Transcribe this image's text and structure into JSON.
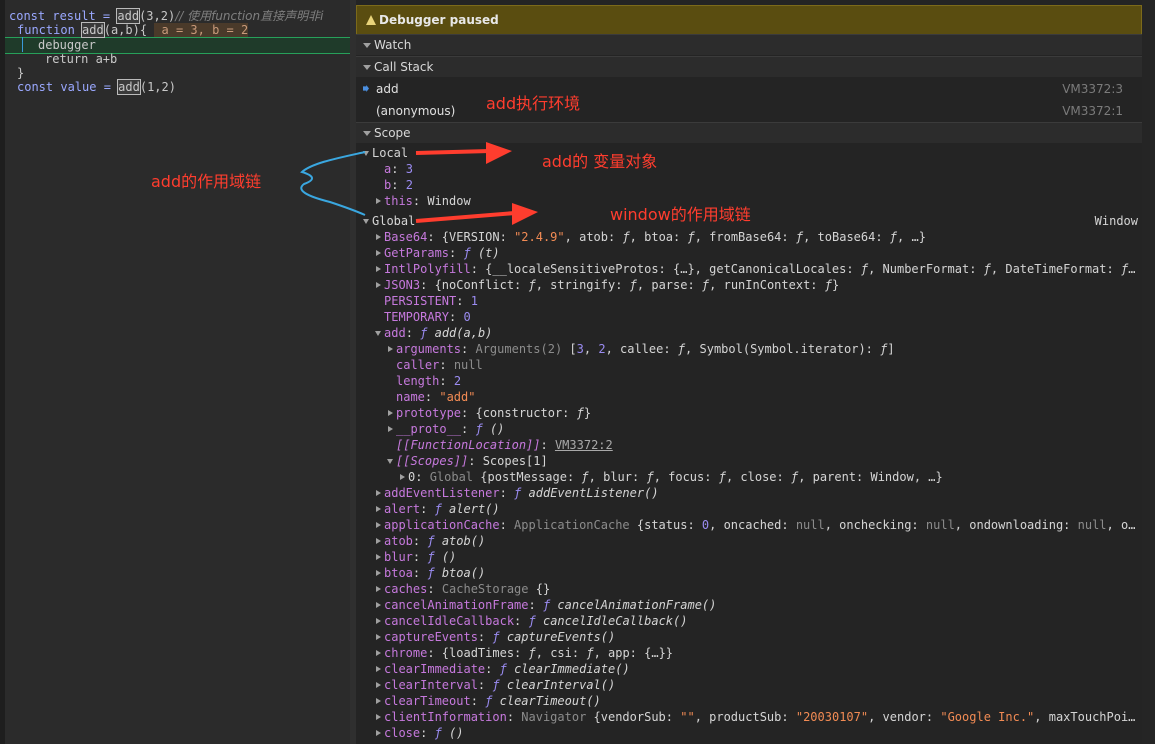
{
  "editor": {
    "line1": {
      "a": "const result = ",
      "fn": "add",
      "b": "(3,2)",
      "c": "// 使用function直接声明非i"
    },
    "line2": {
      "a": "function ",
      "fn": "add",
      "b": "(a,b){ ",
      "v": " a = 3, b = 2"
    },
    "line3": "debugger",
    "line4": "return a+b",
    "line5": "}",
    "line6": {
      "a": "const value = ",
      "fn": "add",
      "b": "(1,2)"
    }
  },
  "debugger": {
    "paused_label": "Debugger paused",
    "watch_label": "Watch",
    "callstack_label": "Call Stack",
    "scope_label": "Scope",
    "call_stack": [
      {
        "fn": "add",
        "loc": "VM3372:3"
      },
      {
        "fn": "(anonymous)",
        "loc": "VM3372:1"
      }
    ],
    "global_value": "Window"
  },
  "scope": {
    "local": "Local",
    "a_key": "a",
    "a_val": "3",
    "b_key": "b",
    "b_val": "2",
    "this_key": "this",
    "this_val": "Window",
    "global": "Global"
  },
  "annotations": {
    "exec_env": "add执行环境",
    "var_obj": "add的 变量对象",
    "scope_chain": "add的作用域链",
    "window_chain": "window的作用域链"
  },
  "colors": {
    "annotation": "#ff3d2e",
    "curly": "#3aa7e0",
    "paused_bg": "#5a4d10"
  }
}
